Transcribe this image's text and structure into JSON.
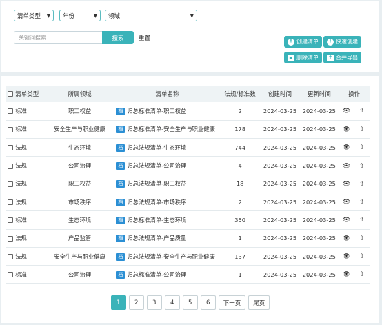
{
  "filters": {
    "list_type": "清单类型",
    "year": "年份",
    "domain": "领域",
    "search_placeholder": "关键词搜索",
    "search_label": "搜索",
    "reset_label": "重置"
  },
  "actions": {
    "create": "创建清单",
    "quick_create": "快速创建",
    "delete": "删除清单",
    "merge_export": "合并导出"
  },
  "table": {
    "headers": {
      "type": "清单类型",
      "domain": "所属领域",
      "name": "清单名称",
      "count": "法规/标准数",
      "created": "创建时间",
      "updated": "更新时间",
      "ops": "操作"
    },
    "badge": "档",
    "rows": [
      {
        "type": "标准",
        "domain": "职工权益",
        "name": "归总标准清单-职工权益",
        "count": "2",
        "created": "2024-03-25",
        "updated": "2024-03-25"
      },
      {
        "type": "标准",
        "domain": "安全生产与职业健康",
        "name": "归总标准清单-安全生产与职业健康",
        "count": "178",
        "created": "2024-03-25",
        "updated": "2024-03-25"
      },
      {
        "type": "法规",
        "domain": "生态环境",
        "name": "归总法规清单-生态环境",
        "count": "744",
        "created": "2024-03-25",
        "updated": "2024-03-25"
      },
      {
        "type": "法规",
        "domain": "公司治理",
        "name": "归总法规清单-公司治理",
        "count": "4",
        "created": "2024-03-25",
        "updated": "2024-03-25"
      },
      {
        "type": "法规",
        "domain": "职工权益",
        "name": "归总法规清单-职工权益",
        "count": "18",
        "created": "2024-03-25",
        "updated": "2024-03-25"
      },
      {
        "type": "法规",
        "domain": "市场秩序",
        "name": "归总法规清单-市场秩序",
        "count": "2",
        "created": "2024-03-25",
        "updated": "2024-03-25"
      },
      {
        "type": "标准",
        "domain": "生态环境",
        "name": "归总标准清单-生态环境",
        "count": "350",
        "created": "2024-03-25",
        "updated": "2024-03-25"
      },
      {
        "type": "法规",
        "domain": "产品监管",
        "name": "归总法规清单-产品质量",
        "count": "1",
        "created": "2024-03-25",
        "updated": "2024-03-25"
      },
      {
        "type": "法规",
        "domain": "安全生产与职业健康",
        "name": "归总法规清单-安全生产与职业健康",
        "count": "137",
        "created": "2024-03-25",
        "updated": "2024-03-25"
      },
      {
        "type": "标准",
        "domain": "公司治理",
        "name": "归总标准清单-公司治理",
        "count": "1",
        "created": "2024-03-25",
        "updated": "2024-03-25"
      }
    ]
  },
  "pagination": {
    "pages": [
      "1",
      "2",
      "3",
      "4",
      "5",
      "6"
    ],
    "current": "1",
    "next": "下一页",
    "last": "尾页"
  },
  "colors": {
    "accent": "#3ab3b9",
    "badge": "#2b8fd4"
  },
  "icons": {
    "view": "eye-icon",
    "export": "export-icon"
  }
}
